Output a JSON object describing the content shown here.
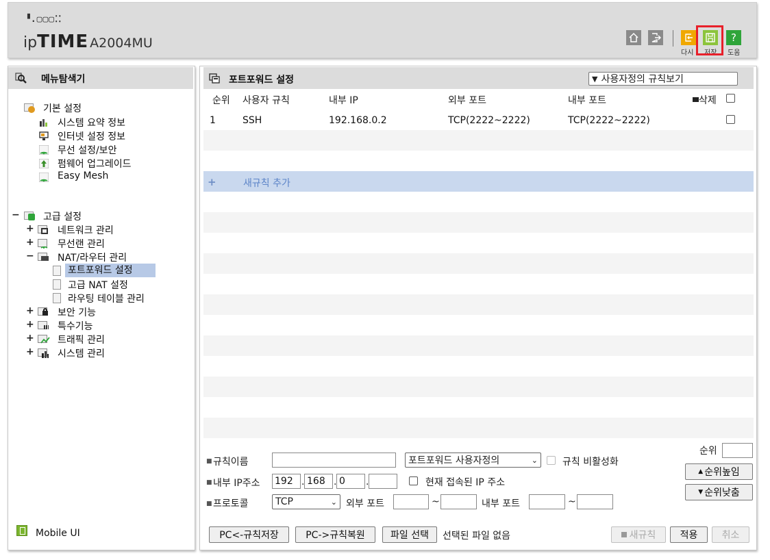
{
  "header": {
    "logo_dots": "▝.▢▢▢⁚⁚",
    "logo_ip": "ip",
    "logo_time": "TIME",
    "model": "A2004MU",
    "buttons": {
      "reload_label": "다시",
      "save_label": "저장",
      "help_label": "도움",
      "help_glyph": "?"
    }
  },
  "left": {
    "title": "메뉴탐색기",
    "basic": {
      "label": "기본 설정",
      "items": [
        "시스템 요약 정보",
        "인터넷 설정 정보",
        "무선 설정/보안",
        "펌웨어 업그레이드",
        "Easy Mesh"
      ]
    },
    "advanced": {
      "toggle": "−",
      "label": "고급 설정",
      "groups": [
        {
          "toggle": "+",
          "label": "네트워크 관리"
        },
        {
          "toggle": "+",
          "label": "무선랜 관리"
        },
        {
          "toggle": "−",
          "label": "NAT/라우터 관리"
        },
        {
          "toggle": "+",
          "label": "보안 기능"
        },
        {
          "toggle": "+",
          "label": "특수기능"
        },
        {
          "toggle": "+",
          "label": "트래픽 관리"
        },
        {
          "toggle": "+",
          "label": "시스템 관리"
        }
      ],
      "nat_items": [
        "포트포워드 설정",
        "고급 NAT 설정",
        "라우팅 테이블 관리"
      ]
    },
    "mobile_ui": "Mobile UI"
  },
  "right": {
    "title": "포트포워드 설정",
    "view_select": "사용자정의 규칙보기",
    "columns": {
      "rank": "순위",
      "rule": "사용자 규칙",
      "internal_ip": "내부 IP",
      "external_port": "외부 포트",
      "internal_port": "내부 포트",
      "delete": "삭제"
    },
    "rows": [
      {
        "rank": "1",
        "rule": "SSH",
        "internal_ip": "192.168.0.2",
        "external_port": "TCP(2222~2222)",
        "internal_port": "TCP(2222~2222)"
      }
    ],
    "add_rule": {
      "plus": "+",
      "label": "새규칙 추가"
    },
    "form": {
      "rule_name_label": "규칙이름",
      "rule_name_value": "",
      "rule_type_select": "포트포워드 사용자정의",
      "disable_label": "규칙 비활성화",
      "ip_label": "내부 IP주소",
      "ip": [
        "192",
        "168",
        "0",
        ""
      ],
      "current_ip_label": "현재 접속된 IP 주소",
      "protocol_label": "프로토콜",
      "protocol_select": "TCP",
      "ext_port_label": "외부 포트",
      "int_port_label": "내부 포트",
      "tilde": "~",
      "rank_label": "순위",
      "rank_up": "순위높임",
      "rank_down": "순위낮춤"
    },
    "bottom": {
      "pc_save": "PC<-규칙저장",
      "pc_restore": "PC->규칙복원",
      "file_select": "파일 선택",
      "no_file": "선택된 파일 없음",
      "new_rule": "새규칙",
      "apply": "적용",
      "cancel": "취소"
    }
  }
}
